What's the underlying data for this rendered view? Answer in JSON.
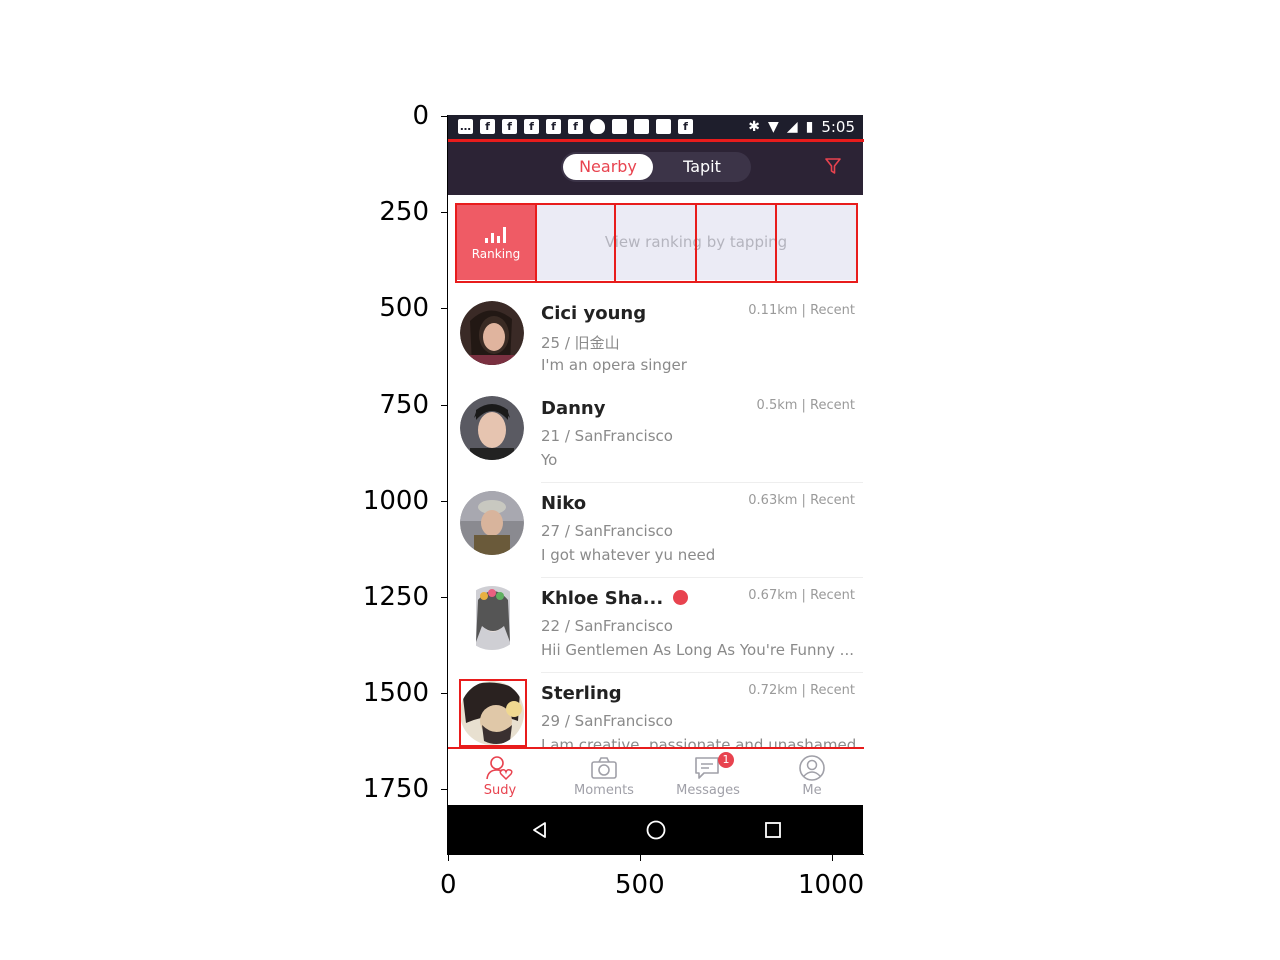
{
  "axes": {
    "y_ticks": [
      "0",
      "250",
      "500",
      "750",
      "1000",
      "1250",
      "1500",
      "1750"
    ],
    "x_ticks": [
      "0",
      "500",
      "1000"
    ]
  },
  "statusbar": {
    "time": "5:05",
    "icons": [
      "chat-icon",
      "facebook-icon",
      "facebook-icon",
      "facebook-icon",
      "facebook-icon",
      "facebook-icon",
      "shield-icon",
      "card-icon",
      "bag-icon",
      "news-icon",
      "facebook-icon",
      "bluetooth-icon",
      "wifi-icon",
      "signal-off-icon",
      "battery-icon"
    ]
  },
  "header": {
    "tabs": [
      "Nearby",
      "Tapit"
    ],
    "active_tab": "Nearby",
    "filter_icon": "filter-icon"
  },
  "banner": {
    "ranking_label": "Ranking",
    "hint": "View ranking by tapping"
  },
  "users": [
    {
      "name": "Cici young",
      "meta": "25 / 旧金山",
      "bio": "I'm an opera singer",
      "distance": "0.11km | Recent"
    },
    {
      "name": "Danny",
      "meta": "21 / SanFrancisco",
      "bio": "Yo",
      "distance": "0.5km | Recent"
    },
    {
      "name": "Niko",
      "meta": "27 / SanFrancisco",
      "bio": "I got whatever yu need",
      "distance": "0.63km | Recent"
    },
    {
      "name": "Khloe Sha...",
      "meta": "22 / SanFrancisco",
      "bio": "Hii Gentlemen As Long As You're Funny ...",
      "distance": "0.67km | Recent"
    },
    {
      "name": "Sterling",
      "meta": "29 / SanFrancisco",
      "bio": "I am creative, passionate and unashamed",
      "distance": "0.72km | Recent"
    }
  ],
  "tabbar": {
    "items": [
      {
        "label": "Sudy",
        "icon": "heart-person-icon"
      },
      {
        "label": "Moments",
        "icon": "camera-icon"
      },
      {
        "label": "Messages",
        "icon": "chat-bubble-icon",
        "badge": "1"
      },
      {
        "label": "Me",
        "icon": "person-icon"
      }
    ],
    "active": "Sudy"
  },
  "navbar": {
    "icons": [
      "back-icon",
      "home-icon",
      "recents-icon"
    ]
  },
  "colors": {
    "accent": "#e8434f",
    "header_bg": "#2c2335",
    "ranking_bg": "#ef5b65",
    "annotation": "#e81c1c"
  }
}
